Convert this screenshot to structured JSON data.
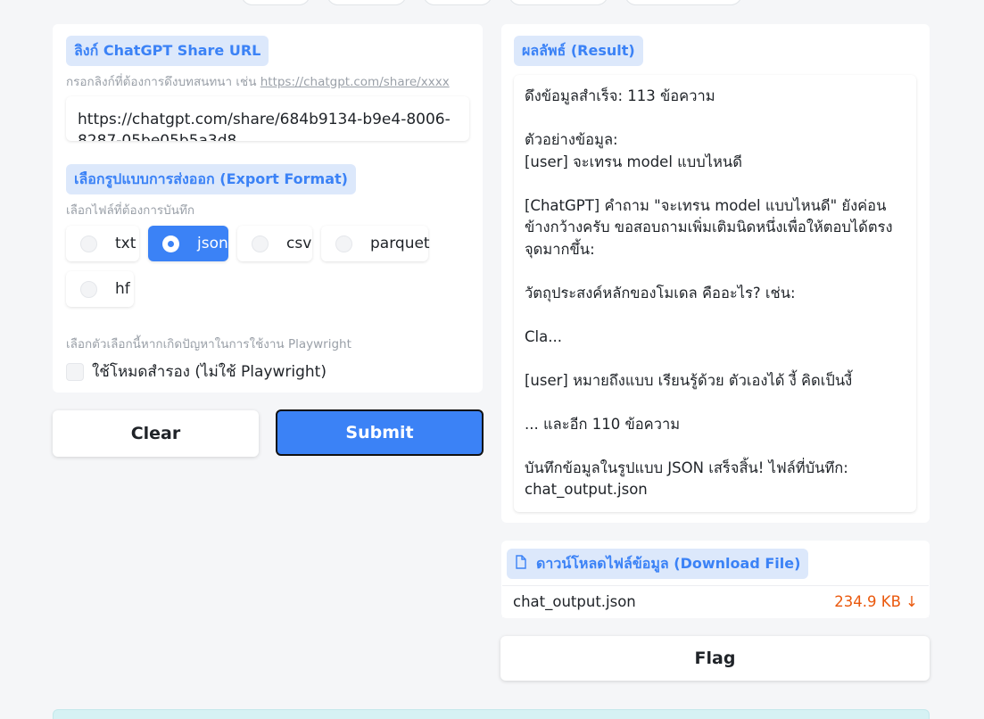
{
  "url_section": {
    "label": "ลิงก์ ChatGPT Share URL",
    "hint_prefix": "กรอกลิงก์ที่ต้องการดึงบทสนทนา เช่น ",
    "hint_link": "https://chatgpt.com/share/xxxx",
    "value": "https://chatgpt.com/share/684b9134-b9e4-8006-8287-05be05b5a3d8"
  },
  "format_section": {
    "label": "เลือกรูปแบบการส่งออก (Export Format)",
    "hint": "เลือกไฟล์ที่ต้องการบันทึก",
    "options": [
      "txt",
      "json",
      "csv",
      "parquet",
      "hf"
    ],
    "selected": "json"
  },
  "fallback_section": {
    "hint": "เลือกตัวเลือกนี้หากเกิดปัญหาในการใช้งาน Playwright",
    "checkbox_label": "ใช้โหมดสำรอง (ไม่ใช้ Playwright)",
    "checked": false
  },
  "buttons": {
    "clear": "Clear",
    "submit": "Submit",
    "flag": "Flag"
  },
  "result_section": {
    "label": "ผลลัพธ์ (Result)",
    "lines": [
      "ดึงข้อมูลสำเร็จ: 113 ข้อความ",
      "",
      "ตัวอย่างข้อมูล:",
      "[user] จะเทรน model แบบไหนดี",
      "",
      "[ChatGPT] คำถาม \"จะเทรน model แบบไหนดี\" ยังค่อนข้างกว้างครับ ขอสอบถามเพิ่มเติมนิดหนึ่งเพื่อให้ตอบได้ตรงจุดมากขึ้น:",
      "",
      "วัตถุประสงค์หลักของโมเดล คืออะไร? เช่น:",
      "",
      "Cla...",
      "",
      "[user] หมายถึงแบบ เรียนรู้ด้วย ตัวเองได้ งี้ คิดเป็นงี้",
      "",
      "... และอีก 110 ข้อความ",
      "",
      "บันทึกข้อมูลในรูปแบบ JSON เสร็จสิ้น! ไฟล์ที่บันทึก: chat_output.json"
    ]
  },
  "download_section": {
    "label": "ดาวน์โหลดไฟล์ข้อมูล (Download File)",
    "file_name": "chat_output.json",
    "file_size": "234.9 KB",
    "download_icon": "↓"
  },
  "colors": {
    "accent": "#3b82f6",
    "chip_bg": "#dce8fb",
    "file_size": "#ea580c"
  }
}
